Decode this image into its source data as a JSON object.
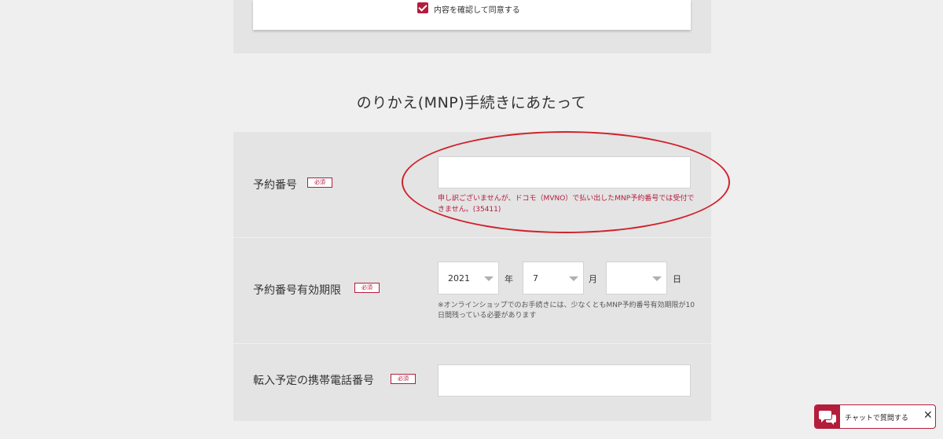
{
  "agreement": {
    "checked": true,
    "label": "内容を確認して同意する"
  },
  "section": {
    "title": "のりかえ(MNP)手続きにあたって"
  },
  "required_badge": "必須",
  "fields": {
    "reservation_number": {
      "label": "予約番号",
      "value": "",
      "error": "申し訳ございませんが、ドコモ（MVNO）で払い出したMNP予約番号では受付できません。(35411)"
    },
    "expiry": {
      "label": "予約番号有効期限",
      "year": "2021",
      "year_unit": "年",
      "month": "7",
      "month_unit": "月",
      "day": "",
      "day_unit": "日",
      "note": "※オンラインショップでのお手続きには、少なくともMNP予約番号有効期限が10日間残っている必要があります"
    },
    "phone": {
      "label": "転入予定の携帯電話番号",
      "value": ""
    }
  },
  "chat": {
    "label": "チャットで質問する",
    "close": "✕"
  },
  "colors": {
    "accent": "#b41c3c",
    "annotation": "#d0222b",
    "panel": "#e4e4e4",
    "background": "#efefef"
  }
}
